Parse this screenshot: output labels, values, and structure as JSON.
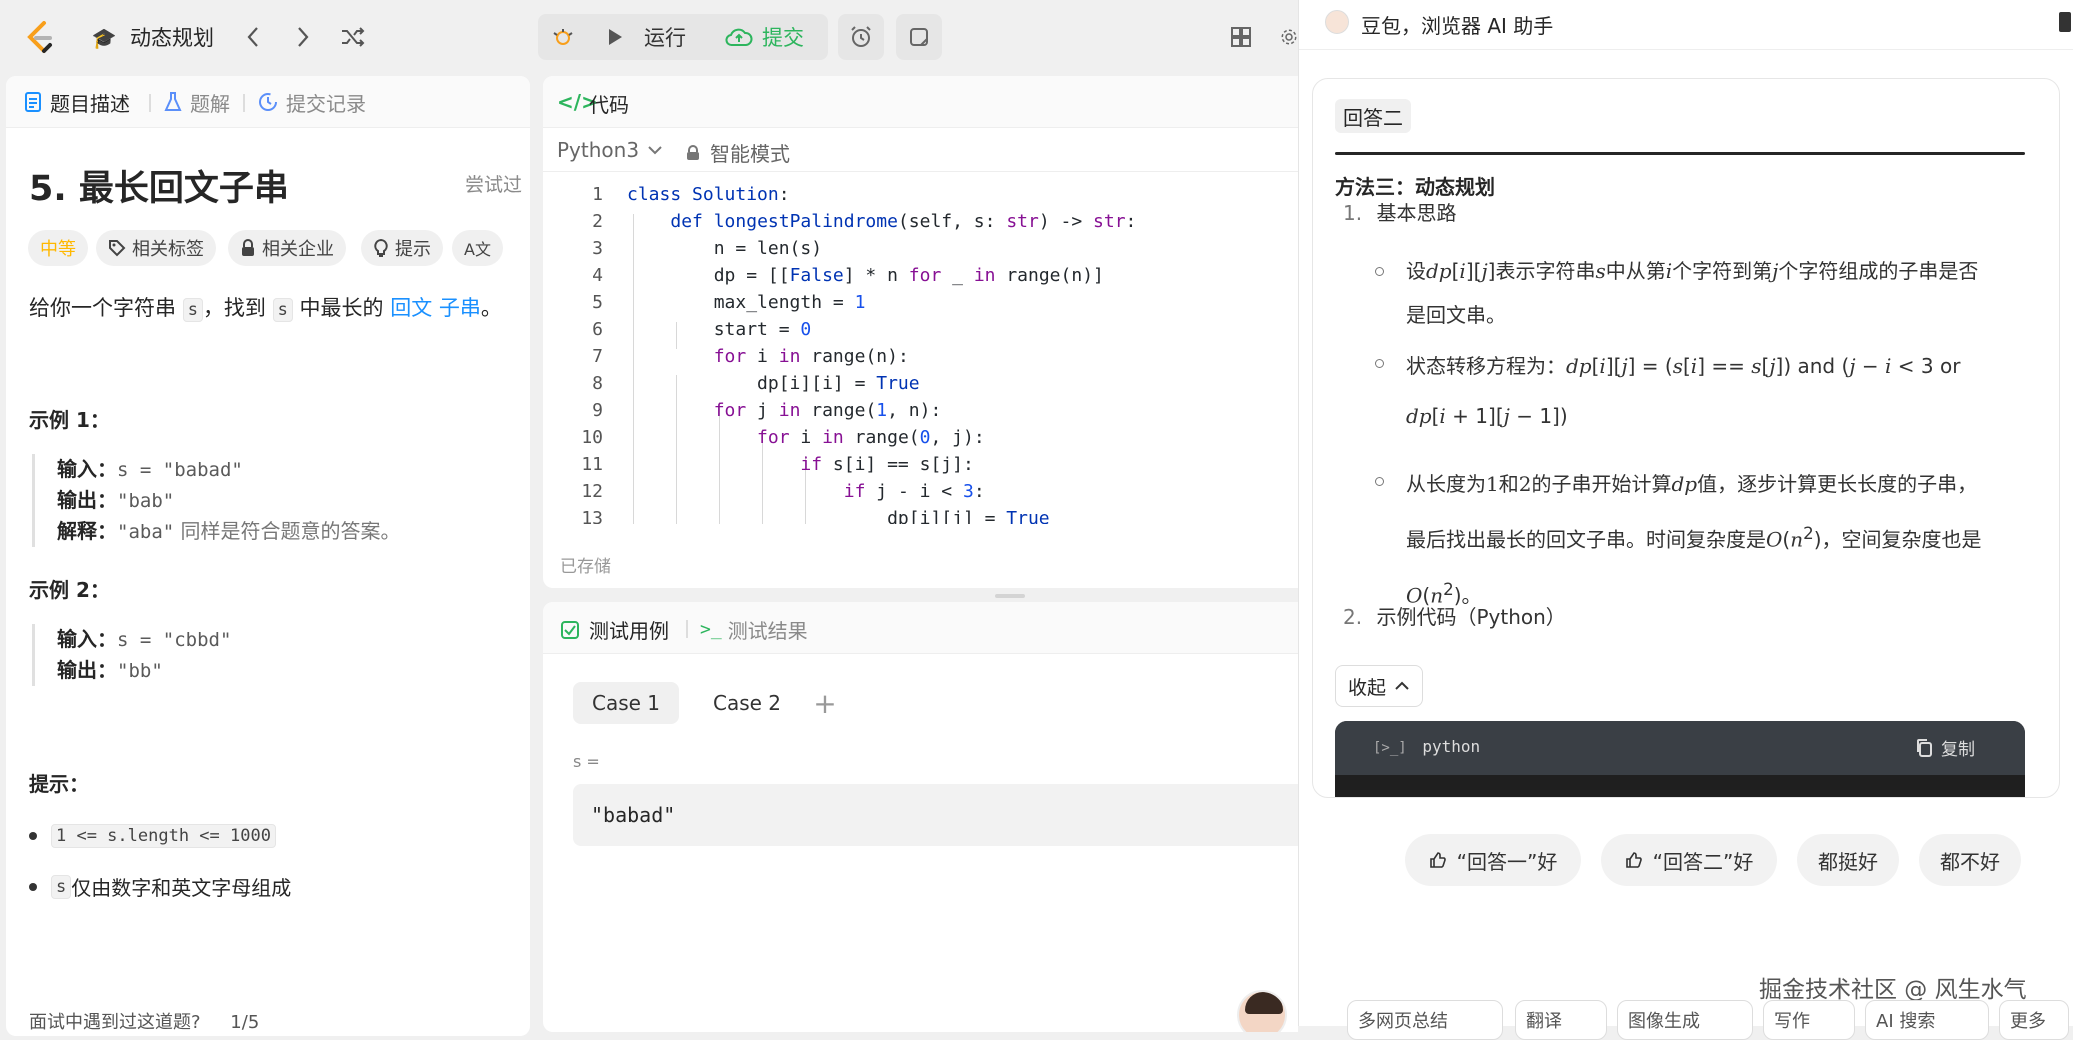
{
  "topbar": {
    "problem_list_title": "动态规划",
    "run_label": "运行",
    "submit_label": "提交"
  },
  "left": {
    "tabs": [
      {
        "label": "题目描述"
      },
      {
        "label": "题解"
      },
      {
        "label": "提交记录"
      }
    ],
    "title": "5. 最长回文子串",
    "tried": "尝试过",
    "tags": {
      "difficulty": "中等",
      "related_tags": "相关标签",
      "related_companies": "相关企业",
      "hint": "提示",
      "translate": "A文"
    },
    "desc": {
      "p1": "给你一个字符串 ",
      "s1": "s",
      "p2": "，找到 ",
      "s2": "s",
      "p3": " 中最长的 ",
      "link1": "回文",
      "link2": "子串",
      "p4": "。"
    },
    "example1": {
      "title": "示例 1：",
      "in_label": "输入：",
      "in_val": "s = \"babad\"",
      "out_label": "输出：",
      "out_val": "\"bab\"",
      "exp_label": "解释：",
      "exp_val": "\"aba\"",
      "exp_tail": " 同样是符合题意的答案。"
    },
    "example2": {
      "title": "示例 2：",
      "in_label": "输入：",
      "in_val": "s = \"cbbd\"",
      "out_label": "输出：",
      "out_val": "\"bb\""
    },
    "hints": {
      "title": "提示：",
      "item1": "1 <= s.length <= 1000",
      "item2_code": "s",
      "item2_text": " 仅由数字和英文字母组成"
    },
    "footer": "面试中遇到过这道题?",
    "footer_page": "1/5"
  },
  "code": {
    "header": "代码",
    "language": "Python3",
    "mode": "智能模式",
    "saved": "已存储",
    "line_numbers": [
      "1",
      "2",
      "3",
      "4",
      "5",
      "6",
      "7",
      "8",
      "9",
      "10",
      "11",
      "12",
      "13"
    ]
  },
  "test": {
    "tab_cases": "测试用例",
    "tab_results": "测试结果",
    "case1": "Case 1",
    "case2": "Case 2",
    "add": "+",
    "var_label": "s =",
    "var_value": "\"babad\""
  },
  "assistant": {
    "title": "豆包，浏览器 AI 助手",
    "answer_tag": "回答二",
    "method": "方法三：动态规划",
    "ol1": "1.",
    "ol1_text": "基本思路",
    "b1a": "设",
    "b1b": "表示字符串",
    "b1c": "中从第",
    "b1d": "个字符到第",
    "b1e": "个字符组成的子串是否",
    "b1f": "是回文串。",
    "b2a": "状态转移方程为：",
    "b2and": "and",
    "b2or": "or",
    "b3a": "从长度为",
    "b3b": "和",
    "b3c": "的子串开始计算",
    "b3d": "值，逐步计算更长长度的子串，",
    "b3e": "最后找出最长的回文子串。时间复杂度是",
    "b3f": "，空间复杂度也是",
    "b3g": "。",
    "ol2": "2.",
    "ol2_text": "示例代码（Python）",
    "collapse": "收起",
    "code_lang": "python",
    "copy": "复制",
    "vote1": "“回答一”好",
    "vote2": "“回答二”好",
    "vote3": "都挺好",
    "vote4": "都不好",
    "watermark": "掘金技术社区 @ 风生水气",
    "chips": [
      "多网页总结",
      "翻译",
      "图像生成",
      "写作",
      "AI 搜索",
      "更多"
    ]
  },
  "colors": {
    "accent_green": "#2db55d",
    "link_blue": "#1a90ff",
    "difficulty_orange": "#ffb800"
  }
}
